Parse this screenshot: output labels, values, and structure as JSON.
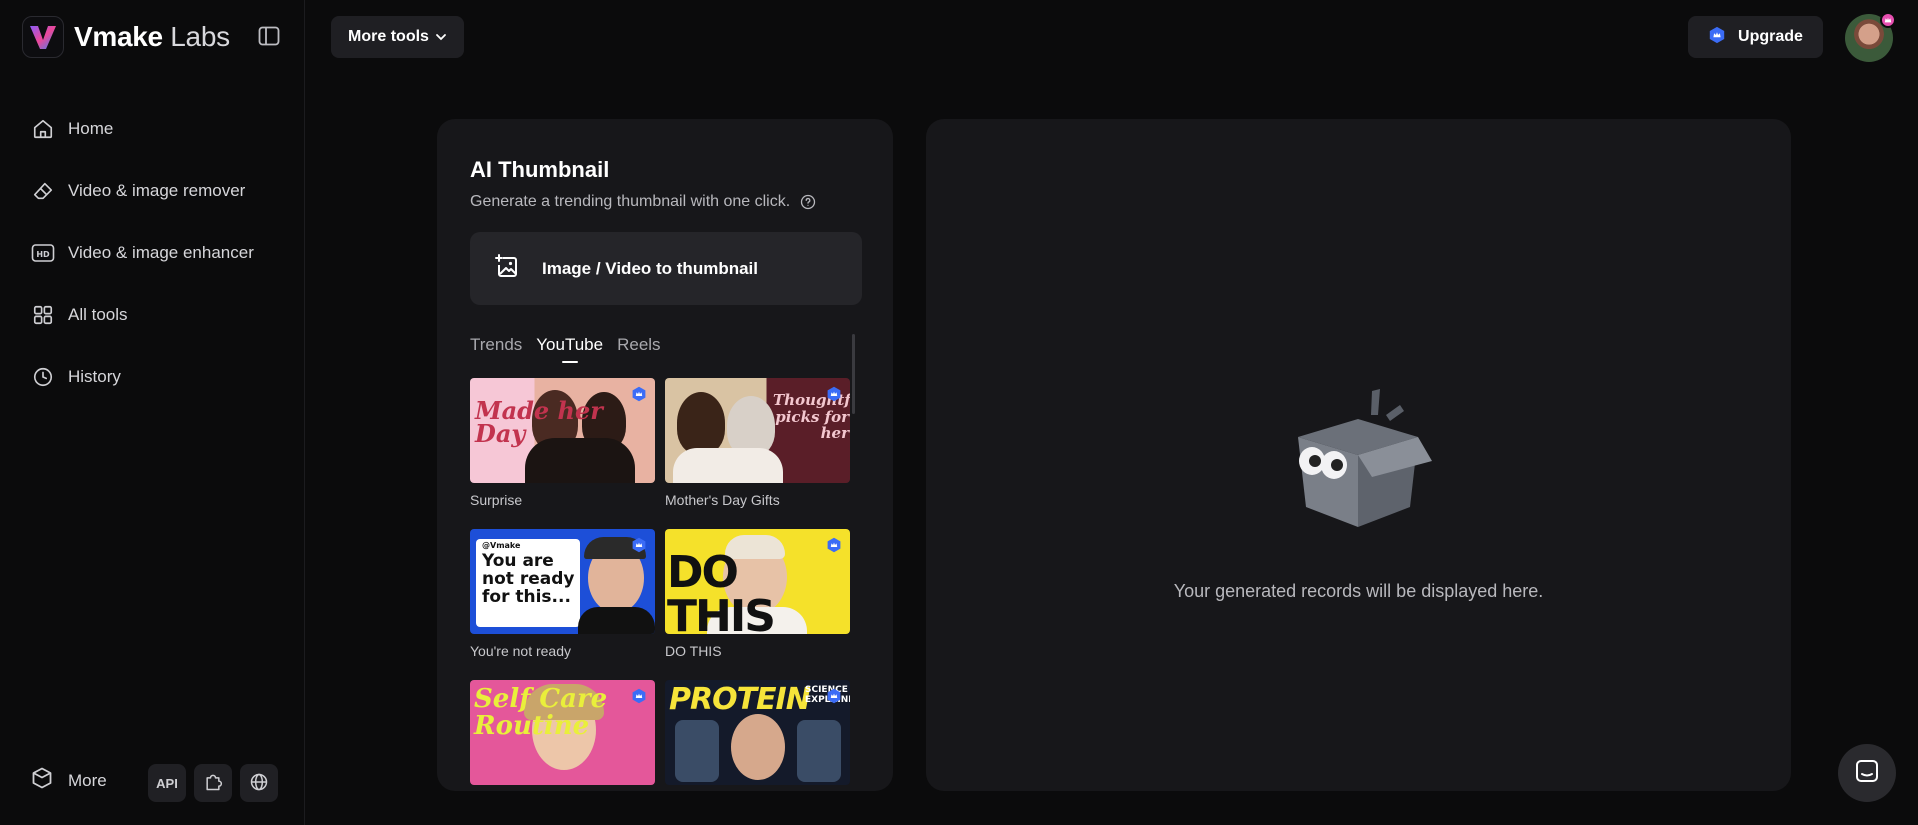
{
  "brand": {
    "name_bold": "Vmake",
    "name_light": "Labs"
  },
  "sidebar": {
    "items": [
      {
        "label": "Home",
        "icon": "home-icon"
      },
      {
        "label": "Video & image remover",
        "icon": "eraser-icon"
      },
      {
        "label": "Video & image enhancer",
        "icon": "hd-icon"
      },
      {
        "label": "All tools",
        "icon": "grid-icon"
      },
      {
        "label": "History",
        "icon": "clock-icon"
      }
    ],
    "more_label": "More",
    "api_label": "API"
  },
  "topbar": {
    "more_tools_label": "More tools",
    "upgrade_label": "Upgrade"
  },
  "panel": {
    "title": "AI Thumbnail",
    "subtitle": "Generate a trending thumbnail with one click.",
    "action_label": "Image / Video to thumbnail",
    "tabs": [
      "Trends",
      "YouTube",
      "Reels"
    ],
    "active_tab": "YouTube",
    "cards": [
      {
        "label": "Surprise",
        "thumb_text": "Made her Day"
      },
      {
        "label": "Mother's Day Gifts",
        "thumb_text": "Thoughtful picks for her"
      },
      {
        "label": "You're not ready",
        "thumb_text": "You are not ready for this...",
        "thumb_tag": "@Vmake"
      },
      {
        "label": "DO THIS",
        "thumb_text": "DO THIS"
      },
      {
        "label": "",
        "thumb_text": "Self Care Routine"
      },
      {
        "label": "",
        "thumb_text": "PROTEIN",
        "thumb_tag": "SCIENCE EXPLAINED"
      }
    ]
  },
  "results": {
    "empty_message": "Your generated records will be displayed here."
  },
  "colors": {
    "background": "#0b0b0c",
    "panel": "#17171a",
    "accent_crown": "#3b6cf6",
    "badge_pink": "#e64fb0"
  }
}
